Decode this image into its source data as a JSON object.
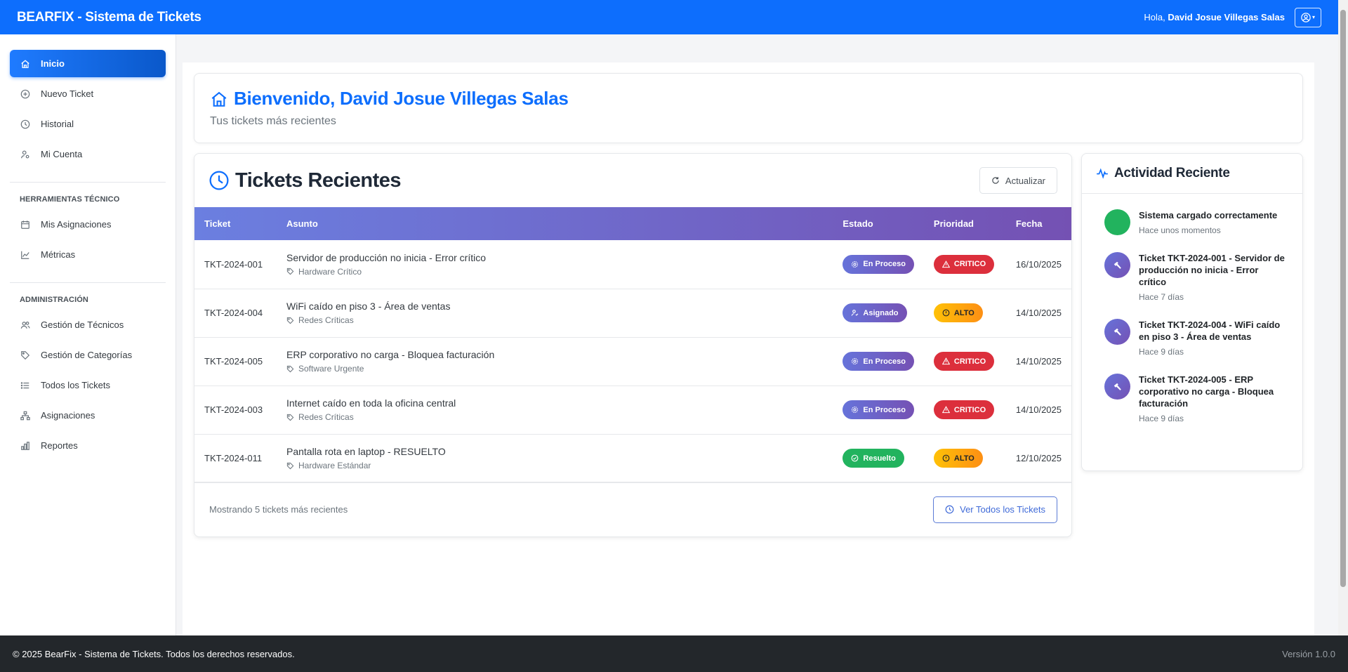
{
  "header": {
    "brand": "BEARFIX - Sistema de Tickets",
    "greeting": "Hola,",
    "user_name": "David Josue Villegas Salas"
  },
  "sidebar": {
    "items": [
      {
        "label": "Inicio",
        "icon": "home-icon"
      },
      {
        "label": "Nuevo Ticket",
        "icon": "plus-circle-icon"
      },
      {
        "label": "Historial",
        "icon": "clock-icon"
      },
      {
        "label": "Mi Cuenta",
        "icon": "user-gear-icon"
      }
    ],
    "section_tech": "HERRAMIENTAS TÉCNICO",
    "tech_items": [
      {
        "label": "Mis Asignaciones",
        "icon": "calendar-icon"
      },
      {
        "label": "Métricas",
        "icon": "chart-line-icon"
      }
    ],
    "section_admin": "ADMINISTRACIÓN",
    "admin_items": [
      {
        "label": "Gestión de Técnicos",
        "icon": "users-icon"
      },
      {
        "label": "Gestión de Categorías",
        "icon": "tags-icon"
      },
      {
        "label": "Todos los Tickets",
        "icon": "list-icon"
      },
      {
        "label": "Asignaciones",
        "icon": "sitemap-icon"
      },
      {
        "label": "Reportes",
        "icon": "bar-chart-icon"
      }
    ]
  },
  "welcome": {
    "title": "Bienvenido, David Josue Villegas Salas",
    "subtitle": "Tus tickets más recientes"
  },
  "tickets": {
    "title": "Tickets Recientes",
    "refresh_label": "Actualizar",
    "columns": [
      "Ticket",
      "Asunto",
      "Estado",
      "Prioridad",
      "Fecha"
    ],
    "rows": [
      {
        "id": "TKT-2024-001",
        "subject": "Servidor de producción no inicia - Error crítico",
        "category": "Hardware Crítico",
        "status": "En Proceso",
        "priority": "CRITICO",
        "date": "16/10/2025"
      },
      {
        "id": "TKT-2024-004",
        "subject": "WiFi caído en piso 3 - Área de ventas",
        "category": "Redes Críticas",
        "status": "Asignado",
        "priority": "ALTO",
        "date": "14/10/2025"
      },
      {
        "id": "TKT-2024-005",
        "subject": "ERP corporativo no carga - Bloquea facturación",
        "category": "Software Urgente",
        "status": "En Proceso",
        "priority": "CRITICO",
        "date": "14/10/2025"
      },
      {
        "id": "TKT-2024-003",
        "subject": "Internet caído en toda la oficina central",
        "category": "Redes Críticas",
        "status": "En Proceso",
        "priority": "CRITICO",
        "date": "14/10/2025"
      },
      {
        "id": "TKT-2024-011",
        "subject": "Pantalla rota en laptop - RESUELTO",
        "category": "Hardware Estándar",
        "status": "Resuelto",
        "priority": "ALTO",
        "date": "12/10/2025"
      }
    ],
    "footer_text": "Mostrando 5 tickets más recientes",
    "view_all_label": "Ver Todos los Tickets"
  },
  "activity": {
    "title": "Actividad Reciente",
    "items": [
      {
        "title": "Sistema cargado correctamente",
        "time": "Hace unos momentos"
      },
      {
        "title": "Ticket TKT-2024-001 - Servidor de producción no inicia - Error crítico",
        "time": "Hace 7 días"
      },
      {
        "title": "Ticket TKT-2024-004 - WiFi caído en piso 3 - Área de ventas",
        "time": "Hace 9 días"
      },
      {
        "title": "Ticket TKT-2024-005 - ERP corporativo no carga - Bloquea facturación",
        "time": "Hace 9 días"
      }
    ]
  },
  "footer": {
    "copyright": "© 2025 BearFix - Sistema de Tickets. Todos los derechos reservados.",
    "version": "Versión 1.0.0"
  },
  "colors": {
    "primary": "#0d6efd",
    "header_gradient_start": "#6b7fe0",
    "header_gradient_end": "#7451b3",
    "critical": "#dc2f3c",
    "high": "#ffc107",
    "resolved": "#22b35e",
    "footer_bg": "#23272b"
  }
}
